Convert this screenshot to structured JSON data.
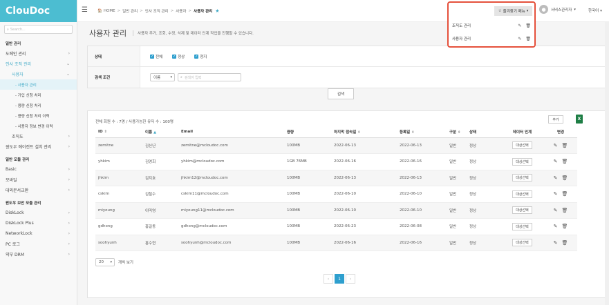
{
  "app": {
    "logo": "ClouDoc"
  },
  "sidebar": {
    "search_placeholder": "Search...",
    "items": [
      {
        "label": "일반 관리",
        "type": "section"
      },
      {
        "label": "도메인 관리",
        "type": "item",
        "chev": "›"
      },
      {
        "label": "인사 조직 관리",
        "type": "item-active",
        "chev": "⌄"
      },
      {
        "label": "사용자",
        "type": "l2-active",
        "chev": "⌄"
      },
      {
        "label": "- 사용자 관리",
        "type": "l3-current"
      },
      {
        "label": "- 가입 신청 처리",
        "type": "l3"
      },
      {
        "label": "- 용량 신청 처리",
        "type": "l3"
      },
      {
        "label": "- 용량 신청 처리 이력",
        "type": "l3"
      },
      {
        "label": "- 사용자 정보 변경 이력",
        "type": "l3"
      },
      {
        "label": "조직도",
        "type": "l2",
        "chev": "›"
      },
      {
        "label": "윈도우 에이전트 설치 관리",
        "type": "item",
        "chev": "›"
      },
      {
        "label": "일반 모듈 관리",
        "type": "section"
      },
      {
        "label": "Basic",
        "type": "item",
        "chev": "›"
      },
      {
        "label": "모바일",
        "type": "item",
        "chev": "›"
      },
      {
        "label": "대외문서교환",
        "type": "item",
        "chev": "›"
      },
      {
        "label": "윈도우 보안 모듈 관리",
        "type": "section"
      },
      {
        "label": "DiskLock",
        "type": "item",
        "chev": "›"
      },
      {
        "label": "DiskLock Plus",
        "type": "item",
        "chev": "›"
      },
      {
        "label": "NetworkLock",
        "type": "item",
        "chev": "›"
      },
      {
        "label": "PC 로그",
        "type": "item",
        "chev": "›"
      },
      {
        "label": "외부 DRM",
        "type": "item",
        "chev": "›"
      }
    ]
  },
  "topbar": {
    "breadcrumb": [
      "HOME",
      "일반 관리",
      "인사 조직 관리",
      "사용자"
    ],
    "breadcrumb_current": "사용자 관리",
    "favorites_label": "즐겨찾기 메뉴",
    "user_name": "서비스관리자",
    "language": "한국어"
  },
  "favorites": {
    "items": [
      {
        "label": "조직도 관리"
      },
      {
        "label": "사용자 관리"
      }
    ]
  },
  "page": {
    "title": "사용자 관리",
    "subtitle": "사용자 추가, 조회, 수정, 삭제 및 데이터 인계 작업을 진행할 수 있습니다."
  },
  "filter": {
    "status_label": "상태",
    "status_options": [
      "전체",
      "정상",
      "정지"
    ],
    "search_label": "검색 조건",
    "search_field": "이름",
    "search_placeholder": "검색어 입력",
    "search_button": "검색"
  },
  "list": {
    "count_text": "전체 회원 수 : 7명 / 사용가능한 유저 수 : 100명",
    "add_button": "추가",
    "excel_icon": "X",
    "columns": [
      "ID",
      "이름",
      "Email",
      "용량",
      "마지막 접속일",
      "등록일",
      "구분",
      "상태",
      "데이터 인계",
      "변경"
    ],
    "handover_button": "대상선택",
    "rows": [
      {
        "id": "zemitne",
        "name": "김신년",
        "email": "zemitne@mcloudoc.com",
        "quota": "100MB",
        "last_login": "2022-06-13",
        "registered": "2022-06-13",
        "type": "일반",
        "status": "정상"
      },
      {
        "id": "yhkim",
        "name": "김영희",
        "email": "yhkim@mcloudoc.com",
        "quota": "1GB 76MB",
        "last_login": "2022-06-16",
        "registered": "2022-06-16",
        "type": "일반",
        "status": "정상"
      },
      {
        "id": "jhkim",
        "name": "김지호",
        "email": "jhkim12@mcloudoc.com",
        "quota": "100MB",
        "last_login": "2022-06-13",
        "registered": "2022-06-13",
        "type": "일반",
        "status": "정상"
      },
      {
        "id": "cskim",
        "name": "김철수",
        "email": "cskim11@mcloudoc.com",
        "quota": "100MB",
        "last_login": "2022-06-10",
        "registered": "2022-06-10",
        "type": "일반",
        "status": "정상"
      },
      {
        "id": "miyoung",
        "name": "이미영",
        "email": "miyoung11@mcloudoc.com",
        "quota": "100MB",
        "last_login": "2022-06-10",
        "registered": "2022-06-10",
        "type": "일반",
        "status": "정상"
      },
      {
        "id": "gdhong",
        "name": "홍길동",
        "email": "gdhong@mcloudoc.com",
        "quota": "100MB",
        "last_login": "2022-06-23",
        "registered": "2022-06-08",
        "type": "일반",
        "status": "정상"
      },
      {
        "id": "soohyunh",
        "name": "홍수현",
        "email": "soohyunh@mcloudoc.com",
        "quota": "100MB",
        "last_login": "2022-06-16",
        "registered": "2022-06-16",
        "type": "일반",
        "status": "정상"
      }
    ],
    "per_page": "20",
    "per_page_label": "개씩 보기",
    "pages": [
      "‹",
      "1",
      "›"
    ]
  },
  "colors": {
    "brand": "#4cbdd1",
    "accent": "#2e9fce",
    "highlight": "#e5503b"
  }
}
